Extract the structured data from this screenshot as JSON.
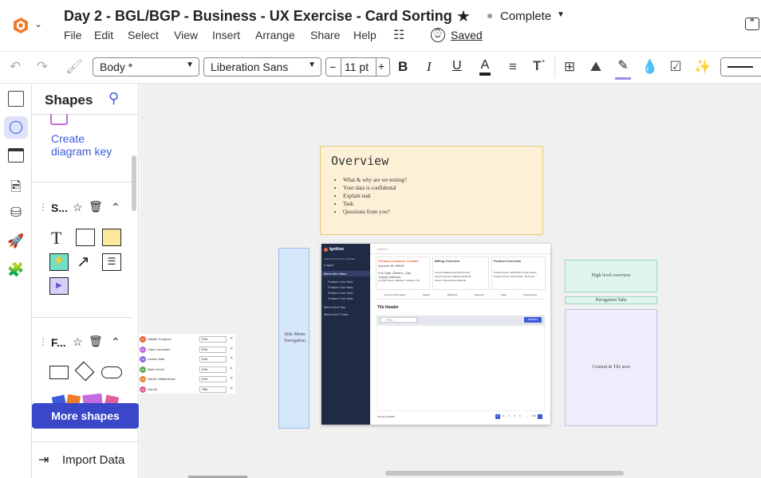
{
  "app": {
    "doc_title": "Day 2 - BGL/BGP - Business - UX Exercise - Card Sorting",
    "status": "Complete",
    "saved": "Saved"
  },
  "menu": [
    "File",
    "Edit",
    "Select",
    "View",
    "Insert",
    "Arrange",
    "Share",
    "Help"
  ],
  "toolbar": {
    "style": "Body *",
    "font": "Liberation Sans",
    "size": "11 pt",
    "bold": "B",
    "italic": "I",
    "underline": "U",
    "text_color": "A",
    "minus": "−",
    "plus": "+"
  },
  "shapes_panel": {
    "title": "Shapes",
    "create_key": "Create diagram key",
    "sec1": "S...",
    "sec2": "F...",
    "more": "More shapes",
    "import": "Import Data"
  },
  "canvas": {
    "overview": {
      "title": "Overview",
      "bullets": [
        "What & why are we testing?",
        "Your data is confidental",
        "Explain task",
        "Task",
        "Questions from you?"
      ]
    },
    "side_nav_label": "Side Menu Navigation",
    "high_level": "High level overview",
    "nav_tabs": "Navigation Tabs",
    "content_tile": "Content & Tile area",
    "users": [
      {
        "i": "NF",
        "n": "Natalie Foxglove",
        "r": "Edit",
        "c": "#e8663c"
      },
      {
        "i": "CL",
        "n": "Clara Lancaster",
        "r": "Edit",
        "c": "#c46be0"
      },
      {
        "i": "LM",
        "n": "Lauren Mair",
        "r": "Edit",
        "c": "#8e6ee8"
      },
      {
        "i": "MG",
        "n": "Mark Grech",
        "r": "Edit",
        "c": "#5fa85a"
      },
      {
        "i": "SW",
        "n": "Steven Walkinshaw",
        "r": "Edit",
        "c": "#e08a3c"
      },
      {
        "i": "AA",
        "n": "Inal Ali",
        "r": "Title",
        "c": "#e0609a"
      }
    ],
    "mock": {
      "brand": "Ignition",
      "sub": "LBZ PRODUCTION LIMITED",
      "logout": "Logout",
      "menu_item": "Menu item Main",
      "sub_items": [
        "Feature Line New",
        "Feature Line New",
        "Feature Line New",
        "Feature Line New"
      ],
      "menu_items2": [
        "Menu Item Two",
        "Menu Item Three"
      ],
      "search": "Search",
      "card1_title": "Primary Customer Contact",
      "card1_rows": [
        "Account ID: 89892",
        "Full Type: Electric, Gas",
        "Supply Address:",
        "27 High Street, Sheffield, Yorkshire, S3"
      ],
      "card2_title": "Billing Overview",
      "card2_rows": [
        "Account Balance   £2,556.44 debit",
        "Latest Customer Balance   £750.00",
        "Recent Transactions   £150.65"
      ],
      "card3_title": "Product Overview",
      "card3_rows": [
        "Product Name: BGCBGP Product Name",
        "Product Name: 02-01-2024 - 02-01-20..."
      ],
      "tabs": [
        "Account Information",
        "Meters",
        "Readings",
        "Metering",
        "Data",
        "Suspensions"
      ],
      "tile_header": "Tile Header",
      "filter": "Filter",
      "button": "Button",
      "footer": "Showing 26,988",
      "pages": [
        "1",
        "2",
        "3",
        "4",
        "5",
        "...",
        "100"
      ]
    }
  },
  "colors": {
    "accent": "#3b5bdb",
    "overview_bg": "#fcf1d6",
    "overview_border": "#e6c77a",
    "blue_note": "#d6e6fb",
    "green_note": "#dff5ee",
    "purple_note": "#eeedfb",
    "navy": "#1f2a44"
  }
}
